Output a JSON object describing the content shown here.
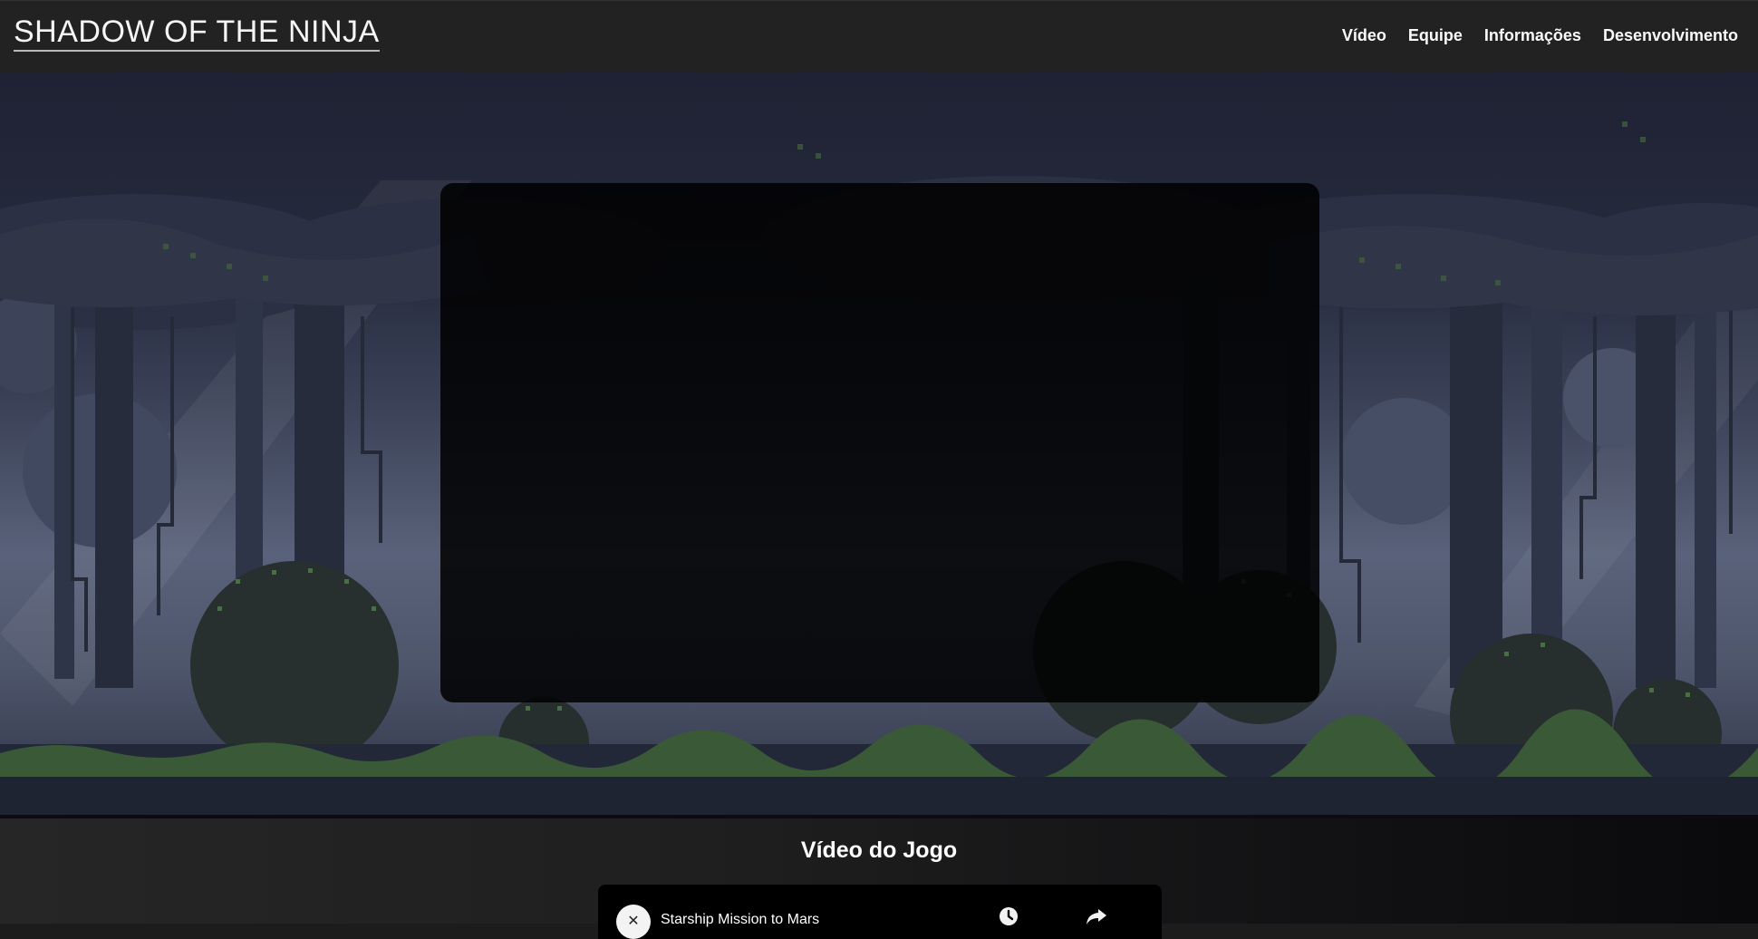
{
  "navbar": {
    "title": "SHADOW OF THE NINJA",
    "links": [
      "Vídeo",
      "Equipe",
      "Informações",
      "Desenvolvimento"
    ]
  },
  "hero": {
    "background": "pixel-forest-scene"
  },
  "video_section": {
    "title": "Vídeo do Jogo",
    "embed": {
      "title": "Starship Mission to Mars",
      "channel_icon": "x-logo-icon",
      "actions": [
        "clock-icon",
        "share-icon"
      ]
    }
  },
  "colors": {
    "navbar_bg": "#222222",
    "panel_overlay": "#000000",
    "foliage": "#3e5e3a"
  }
}
